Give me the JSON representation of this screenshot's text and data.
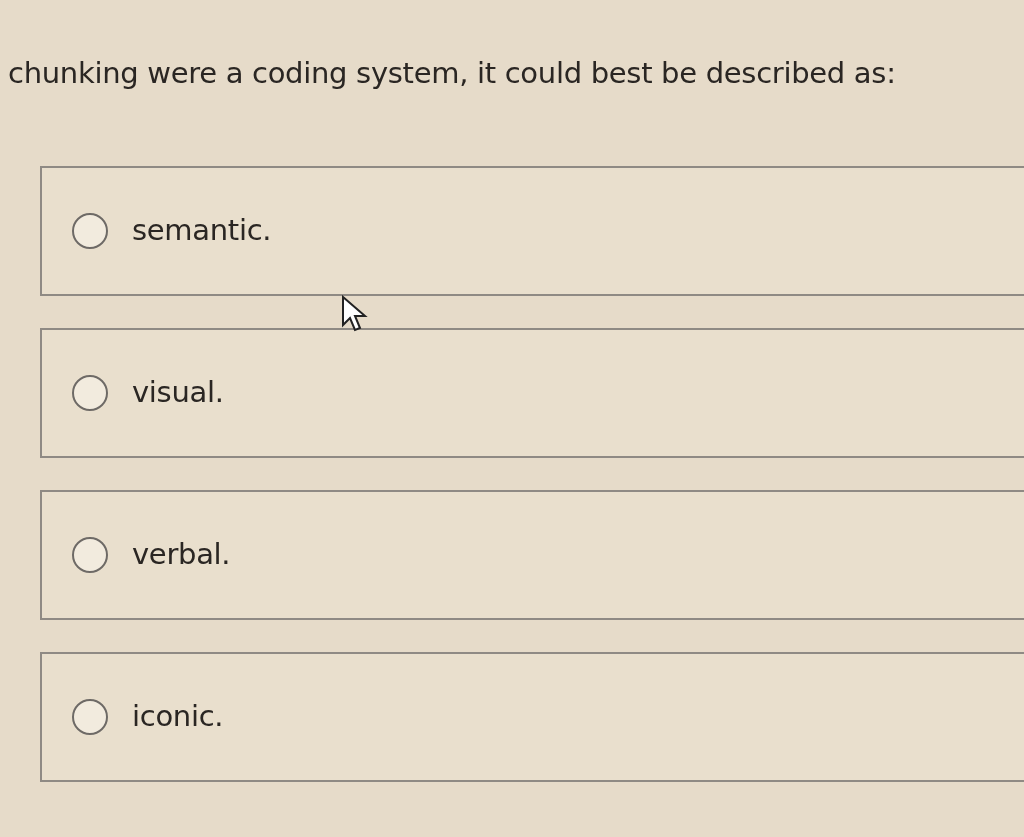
{
  "question": "chunking were a coding system, it could best be described as:",
  "options": [
    {
      "label": "semantic.",
      "selected": false
    },
    {
      "label": "visual.",
      "selected": false
    },
    {
      "label": "verbal.",
      "selected": false
    },
    {
      "label": "iconic.",
      "selected": false
    }
  ]
}
